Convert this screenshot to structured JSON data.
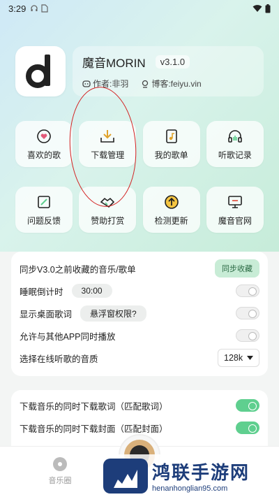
{
  "status_bar": {
    "time": "3:29"
  },
  "header": {
    "app_name": "魔音MORIN",
    "version": "v3.1.0",
    "author_label": "作者:非羽",
    "blog_label": "博客:feiyu.vin"
  },
  "grid_row1": [
    {
      "label": "喜欢的歌",
      "icon": "heart-icon"
    },
    {
      "label": "下载管理",
      "icon": "download-icon"
    },
    {
      "label": "我的歌单",
      "icon": "playlist-icon"
    },
    {
      "label": "听歌记录",
      "icon": "headphones-icon"
    }
  ],
  "grid_row2": [
    {
      "label": "问题反馈",
      "icon": "feedback-icon"
    },
    {
      "label": "赞助打赏",
      "icon": "handshake-icon"
    },
    {
      "label": "检测更新",
      "icon": "update-icon"
    },
    {
      "label": "魔音官网",
      "icon": "monitor-icon"
    }
  ],
  "settings": {
    "sync_label": "同步V3.0之前收藏的音乐/歌单",
    "sync_button": "同步收藏",
    "sleep_label": "睡眠倒计时",
    "sleep_value": "30:00",
    "desktop_lyrics_label": "显示桌面歌词",
    "float_permission_button": "悬浮窗权限?",
    "allow_other_apps_label": "允许与其他APP同时播放",
    "quality_label": "选择在线听歌的音质",
    "quality_value": "128k"
  },
  "settings2": {
    "download_lyrics_label": "下载音乐的同时下载歌词（匹配歌词）",
    "download_cover_label": "下载音乐的同时下载封面（匹配封面）"
  },
  "bottom_nav": {
    "music_hall_label": "音乐圈"
  },
  "watermark": {
    "title": "鸿联手游网",
    "url": "henanhonglian95.com"
  },
  "colors": {
    "accent_green": "#5fcf8f",
    "annotation_red": "#d32020"
  }
}
